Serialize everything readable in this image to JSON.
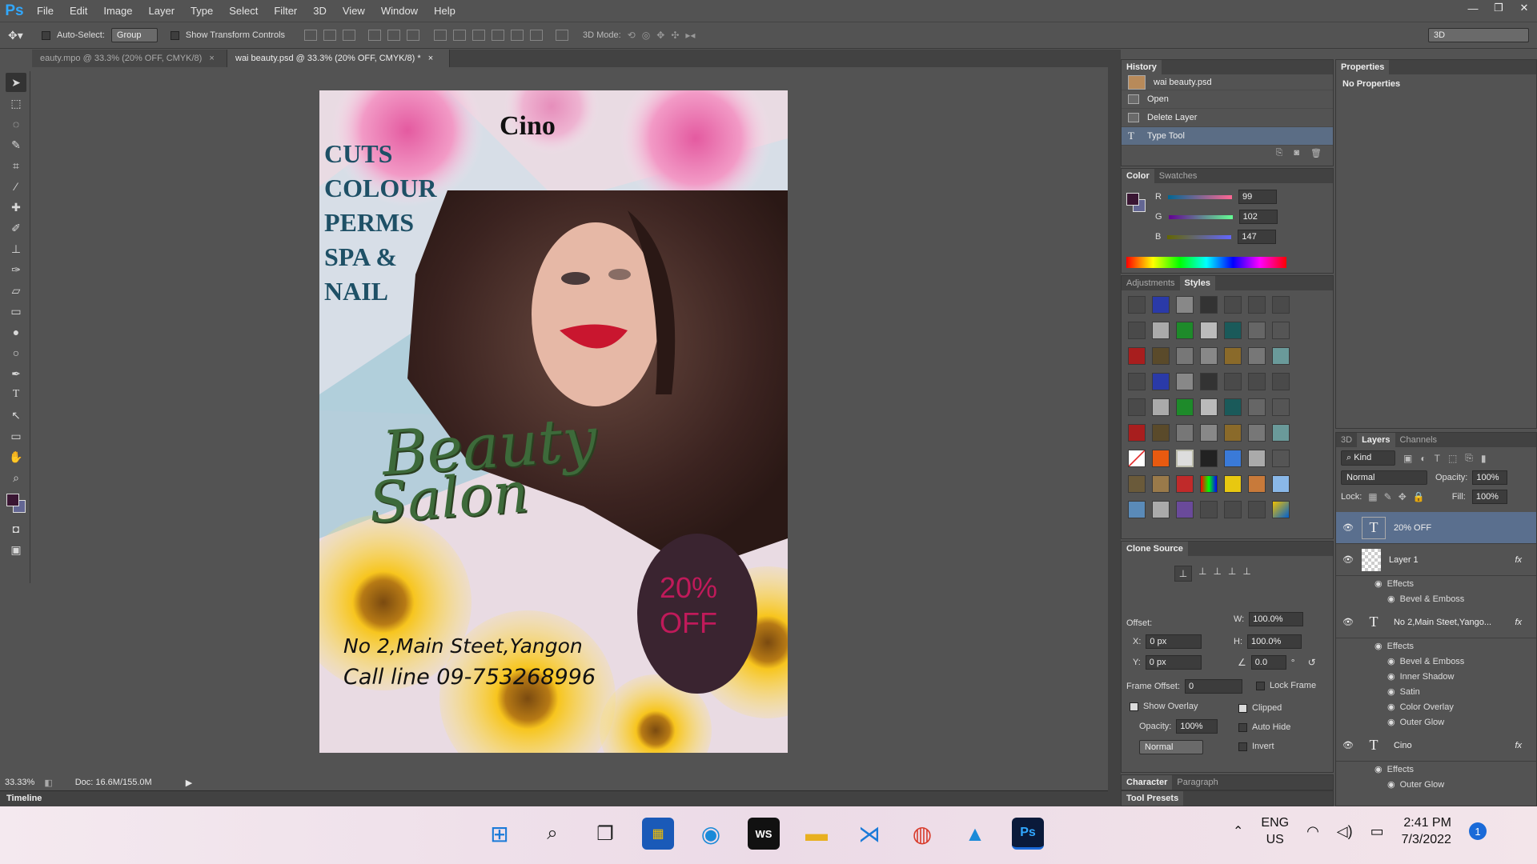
{
  "menubar": {
    "logo": "Ps",
    "items": [
      "File",
      "Edit",
      "Image",
      "Layer",
      "Type",
      "Select",
      "Filter",
      "3D",
      "View",
      "Window",
      "Help"
    ]
  },
  "options": {
    "auto_select_label": "Auto-Select:",
    "auto_select_value": "Group",
    "show_transform_label": "Show Transform Controls",
    "mode_label": "3D Mode:",
    "workspace": "3D"
  },
  "tabs": [
    {
      "label": "eauty.mpo @ 33.3% (20% OFF, CMYK/8)",
      "close": "×"
    },
    {
      "label": "wai beauty.psd @ 33.3% (20% OFF, CMYK/8) *",
      "close": "×"
    }
  ],
  "poster": {
    "brand": "Cino",
    "services": [
      "CUTS",
      "COLOUR",
      "PERMS",
      "SPA &",
      "NAIL"
    ],
    "title_line1": "Beauty",
    "title_line2": "Salon",
    "discount_line1": "20%",
    "discount_line2": "OFF",
    "address": "No 2,Main Steet,Yangon",
    "phone": "Call line 09-753268996"
  },
  "status": {
    "zoom": "33.33%",
    "doc": "Doc: 16.6M/155.0M"
  },
  "timeline_label": "Timeline",
  "history": {
    "title": "History",
    "snapshot": "wai beauty.psd",
    "items": [
      "Open",
      "Delete Layer",
      "Type Tool"
    ]
  },
  "color": {
    "tabs": [
      "Color",
      "Swatches"
    ],
    "channels": [
      {
        "label": "R",
        "value": "99"
      },
      {
        "label": "G",
        "value": "102"
      },
      {
        "label": "B",
        "value": "147"
      }
    ],
    "foreground": "#3a1633"
  },
  "styles": {
    "tabs": [
      "Adjustments",
      "Styles"
    ]
  },
  "clone": {
    "title": "Clone Source",
    "offset_label": "Offset:",
    "w_label": "W:",
    "w_value": "100.0%",
    "h_label": "H:",
    "h_value": "100.0%",
    "x_label": "X:",
    "x_value": "0 px",
    "y_label": "Y:",
    "y_value": "0 px",
    "angle_value": "0.0",
    "angle_unit": "°",
    "frame_offset_label": "Frame Offset:",
    "frame_offset_value": "0",
    "lock_frame": "Lock Frame",
    "show_overlay": "Show Overlay",
    "clipped": "Clipped",
    "opacity_label": "Opacity:",
    "opacity_value": "100%",
    "auto_hide": "Auto Hide",
    "blend": "Normal",
    "invert": "Invert"
  },
  "bottom_tabs": [
    "Character",
    "Paragraph"
  ],
  "tool_presets": "Tool Presets",
  "properties": {
    "title": "Properties",
    "empty": "No Properties"
  },
  "layers": {
    "tabs": [
      "3D",
      "Layers",
      "Channels"
    ],
    "kind": "Kind",
    "blend": "Normal",
    "opacity_label": "Opacity:",
    "opacity_value": "100%",
    "lock_label": "Lock:",
    "fill_label": "Fill:",
    "fill_value": "100%",
    "items": [
      {
        "name": "20% OFF",
        "type": "T"
      },
      {
        "name": "Layer 1",
        "type": "img",
        "effects": [
          "Bevel & Emboss"
        ]
      },
      {
        "name": "No 2,Main Steet,Yango...",
        "type": "T",
        "effects": [
          "Bevel & Emboss",
          "Inner Shadow",
          "Satin",
          "Color Overlay",
          "Outer Glow"
        ]
      },
      {
        "name": "Cino",
        "type": "T",
        "effects": [
          "Outer Glow"
        ]
      }
    ],
    "effects_label": "Effects",
    "fx": "fx"
  },
  "taskbar": {
    "lang1": "ENG",
    "lang2": "US",
    "time": "2:41 PM",
    "date": "7/3/2022",
    "badge": "1"
  }
}
